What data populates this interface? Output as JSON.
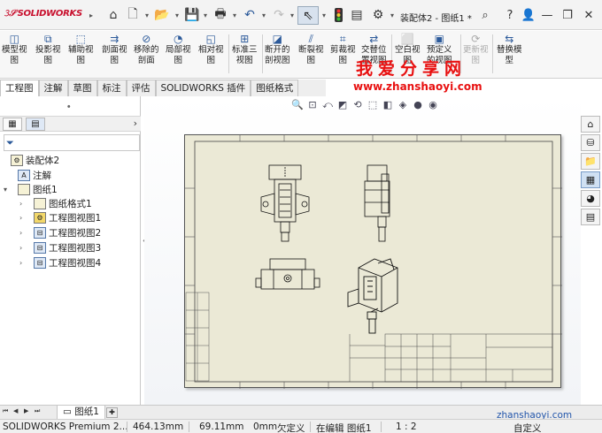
{
  "app": {
    "logo_text": "SOLIDWORKS",
    "document_title": "装配体2 - 图纸1 *"
  },
  "quick_access": {
    "icons": [
      "home-icon",
      "new-icon",
      "open-icon",
      "save-icon",
      "print-icon",
      "undo-icon",
      "redo-icon",
      "select-icon",
      "traffic-light-icon",
      "file-properties-icon",
      "options-icon"
    ],
    "window_controls": [
      "search-icon",
      "help-icon",
      "user-icon",
      "minimize-icon",
      "restore-icon",
      "close-icon"
    ]
  },
  "ribbon": {
    "buttons": [
      {
        "label": "模型视\n图",
        "icon": "model-view-icon",
        "enabled": true
      },
      {
        "label": "投影视\n图",
        "icon": "projected-view-icon",
        "enabled": true
      },
      {
        "label": "辅助视\n图",
        "icon": "auxiliary-view-icon",
        "enabled": true
      },
      {
        "label": "剖面视\n图",
        "icon": "section-view-icon",
        "enabled": true
      },
      {
        "label": "移除的\n剖面",
        "icon": "removed-section-icon",
        "enabled": true
      },
      {
        "label": "局部视\n图",
        "icon": "detail-view-icon",
        "enabled": true
      },
      {
        "label": "相对视\n图",
        "icon": "relative-view-icon",
        "enabled": true
      },
      {
        "label": "标准三\n视图",
        "icon": "standard-3-view-icon",
        "enabled": true
      },
      {
        "label": "断开的\n剖视图",
        "icon": "broken-out-section-icon",
        "enabled": true
      },
      {
        "label": "断裂视\n图",
        "icon": "break-view-icon",
        "enabled": true
      },
      {
        "label": "剪裁视\n图",
        "icon": "crop-view-icon",
        "enabled": true
      },
      {
        "label": "交替位\n置视图",
        "icon": "alternate-position-view-icon",
        "enabled": true
      },
      {
        "label": "空白视\n图",
        "icon": "empty-view-icon",
        "enabled": true
      },
      {
        "label": "预定义\n的视图",
        "icon": "predefined-view-icon",
        "enabled": true
      },
      {
        "label": "更新视\n图",
        "icon": "update-views-icon",
        "enabled": false
      },
      {
        "label": "替换模\n型",
        "icon": "replace-model-icon",
        "enabled": true
      }
    ]
  },
  "watermark": {
    "title": "我爱分享网",
    "url": "www.zhanshaoyi.com",
    "url_bottom": "zhanshaoyi.com"
  },
  "tabs": [
    "工程图",
    "注解",
    "草图",
    "标注",
    "评估",
    "SOLIDWORKS 插件",
    "图纸格式"
  ],
  "active_tab": "工程图",
  "feature_tree": {
    "items": [
      {
        "label": "装配体2",
        "level": 0,
        "expander": "",
        "icon": "assembly-icon"
      },
      {
        "label": "注解",
        "level": 1,
        "expander": "",
        "icon": "annotations-icon"
      },
      {
        "label": "图纸1",
        "level": 1,
        "expander": "▾",
        "icon": "sheet-icon"
      },
      {
        "label": "图纸格式1",
        "level": 2,
        "expander": "›",
        "icon": "sheet-format-icon"
      },
      {
        "label": "工程图视图1",
        "level": 2,
        "expander": "›",
        "icon": "drawing-view-icon"
      },
      {
        "label": "工程图视图2",
        "level": 2,
        "expander": "›",
        "icon": "drawing-view-icon"
      },
      {
        "label": "工程图视图3",
        "level": 2,
        "expander": "›",
        "icon": "drawing-view-icon"
      },
      {
        "label": "工程图视图4",
        "level": 2,
        "expander": "›",
        "icon": "drawing-view-icon"
      }
    ]
  },
  "sheet_tabs": {
    "active": "图纸1"
  },
  "status_bar": {
    "product": "SOLIDWORKS Premium 2...",
    "x": "464.13mm",
    "y": "69.11mm",
    "z": "0mm",
    "definition": "欠定义",
    "editing": "在编辑 图纸1",
    "scale": "1 : 2",
    "units": "自定义"
  },
  "colors": {
    "sheet_bg": "#ebe9d6",
    "accent": "#2c5a9a",
    "watermark": "#e81010",
    "logo": "#c8102e"
  }
}
